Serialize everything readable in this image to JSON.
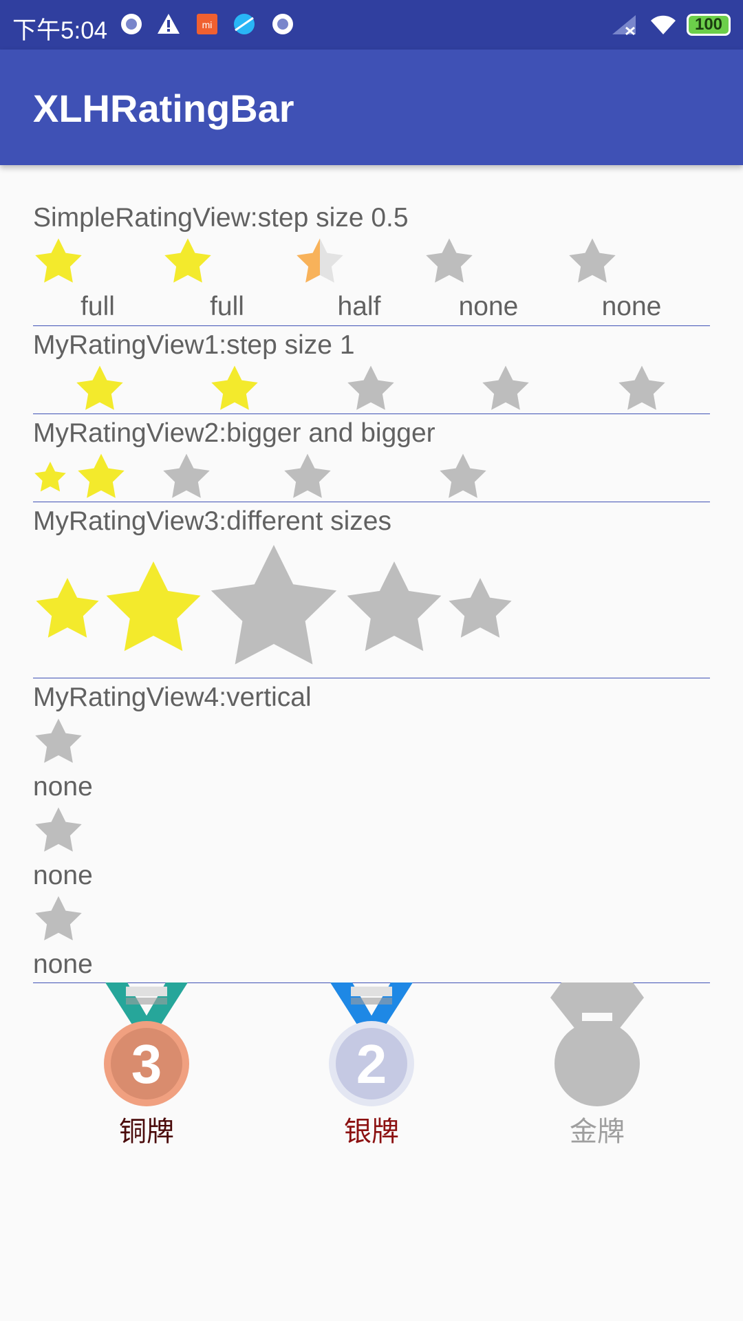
{
  "status_bar": {
    "time": "下午5:04",
    "battery": "100"
  },
  "app_bar": {
    "title": "XLHRatingBar"
  },
  "colors": {
    "status_bar": "#303f9f",
    "app_bar": "#3f51b5",
    "star_filled": "#f3ea2c",
    "star_half": "#f8b25a",
    "star_empty": "#bdbdbd",
    "divider": "#3f51b5"
  },
  "simple_rating_view": {
    "title": "SimpleRatingView:step size 0.5",
    "rating": 2.5,
    "stars": [
      {
        "state": "full",
        "label": "full"
      },
      {
        "state": "full",
        "label": "full"
      },
      {
        "state": "half",
        "label": "half"
      },
      {
        "state": "none",
        "label": "none"
      },
      {
        "state": "none",
        "label": "none"
      }
    ]
  },
  "my_rating_view1": {
    "title": "MyRatingView1:step size 1",
    "rating": 2,
    "count": 5
  },
  "my_rating_view2": {
    "title": "MyRatingView2:bigger and bigger",
    "rating": 2,
    "count": 5
  },
  "my_rating_view3": {
    "title": "MyRatingView3:different sizes",
    "rating": 2,
    "count": 5
  },
  "my_rating_view4": {
    "title": "MyRatingView4:vertical",
    "rating": 0,
    "items": [
      {
        "state": "none",
        "label": "none"
      },
      {
        "state": "none",
        "label": "none"
      },
      {
        "state": "none",
        "label": "none"
      }
    ]
  },
  "medals": {
    "rating": 2,
    "items": [
      {
        "icon": "bronze-medal-icon",
        "number": "3",
        "label": "铜牌",
        "label_color": "#4a0a0a"
      },
      {
        "icon": "silver-medal-icon",
        "number": "2",
        "label": "银牌",
        "label_color": "#8b1010"
      },
      {
        "icon": "gold-medal-icon",
        "number": "",
        "label": "金牌",
        "label_color": "#9e9e9e"
      }
    ]
  }
}
